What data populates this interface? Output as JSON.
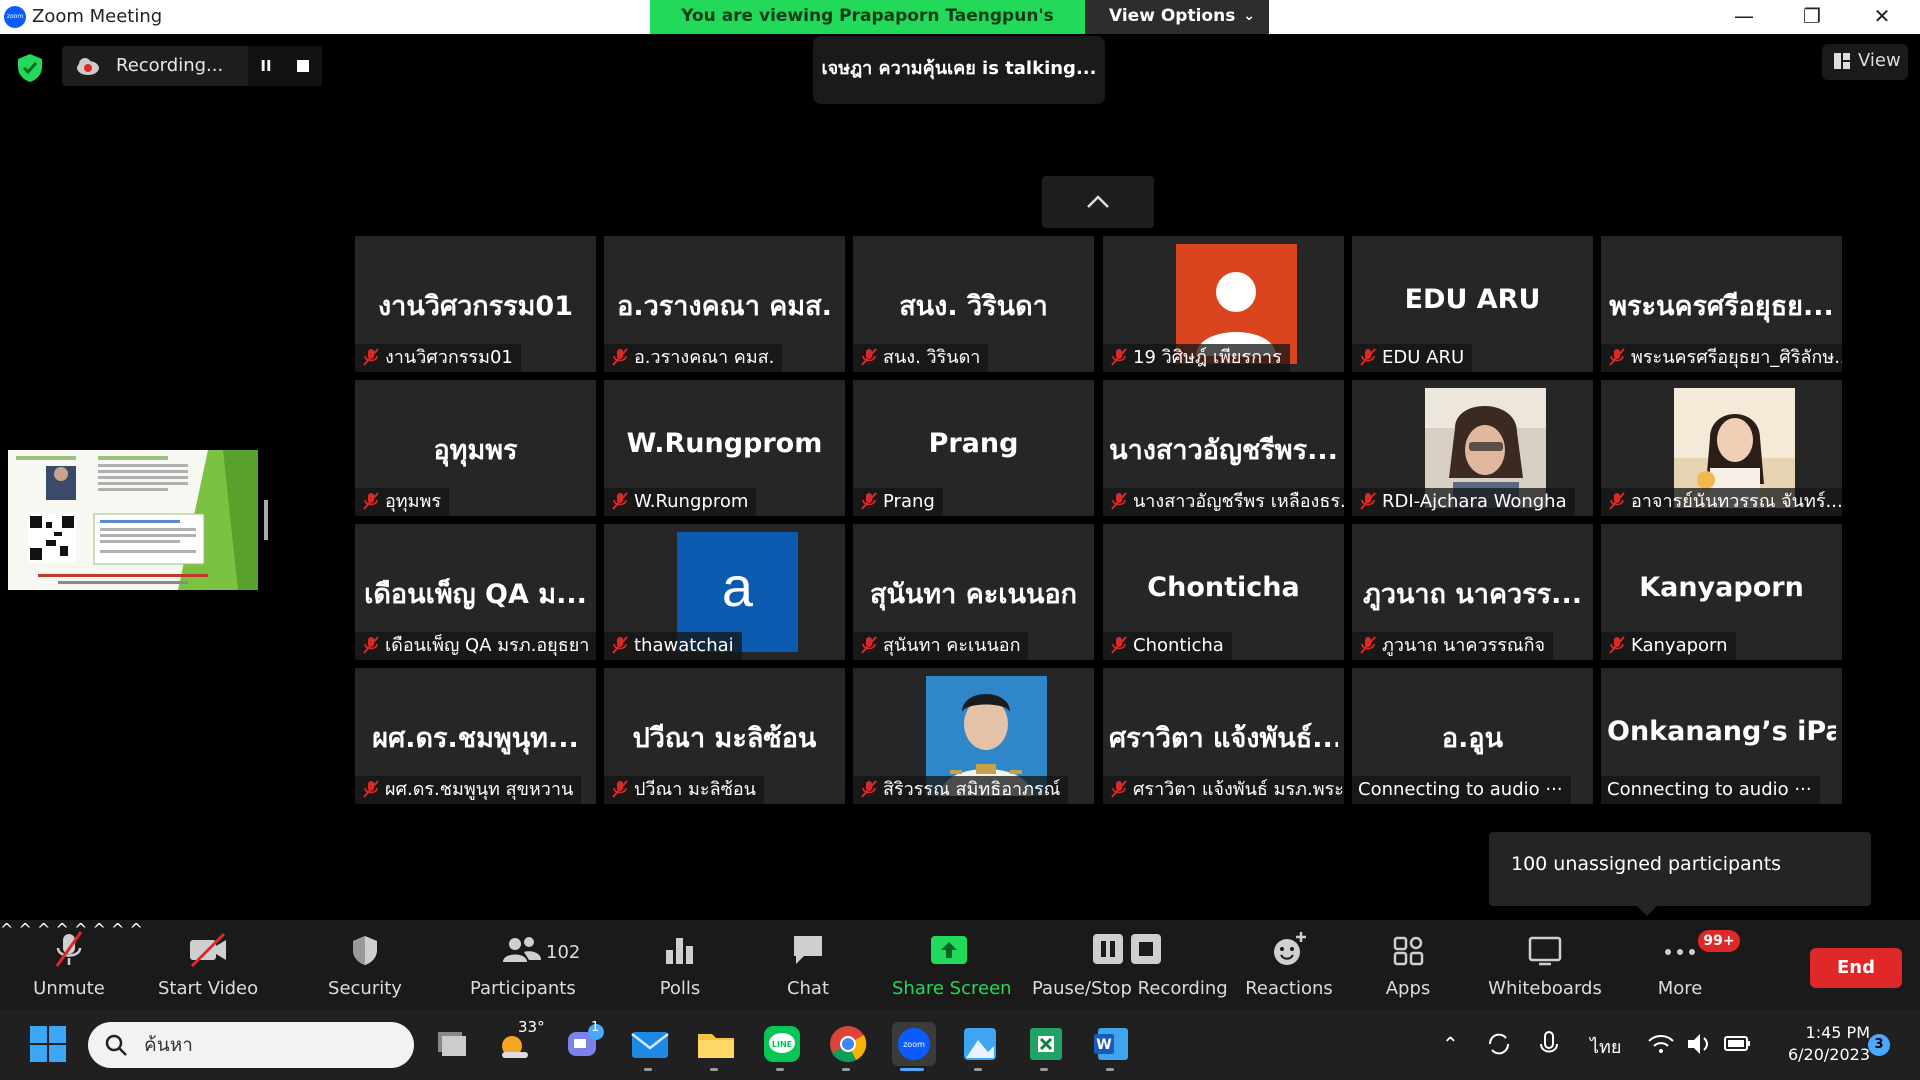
{
  "window": {
    "title": "Zoom Meeting",
    "share_banner": "You are viewing Prapaporn Taengpun's screen",
    "view_options": "View Options",
    "minimize": "—",
    "maximize": "❐",
    "close": "✕"
  },
  "recording": {
    "label": "Recording...",
    "pause": "II"
  },
  "talking": "เจษฎา ความคุ้นเคย is  talking...",
  "view_button": "View",
  "colors": {
    "share_green": "#23d959",
    "muted_red": "#e02828",
    "tile_bg": "#262626",
    "accent_green": "#23d959"
  },
  "participants": [
    {
      "display": "งานวิศวกรรม01",
      "label": "งานวิศวกรรม01",
      "muted": true
    },
    {
      "display": "อ.วรางคณา คมส.",
      "label": "อ.วรางคณา คมส.",
      "muted": true
    },
    {
      "display": "สนง. วิรินดา",
      "label": "สนง. วิรินดา",
      "muted": true
    },
    {
      "display": "",
      "label": "19 วิศิษฎ์ เพียรการ",
      "muted": true,
      "photo": "default-avatar"
    },
    {
      "display": "EDU ARU",
      "label": "EDU ARU",
      "muted": true
    },
    {
      "display": "พระนครศรีอยุธย...",
      "label": "พระนครศรีอยุธยา_ศิริลักษ...",
      "muted": true
    },
    {
      "display": "อุทุมพร",
      "label": "อุทุมพร",
      "muted": true
    },
    {
      "display": "W.Rungprom",
      "label": "W.Rungprom",
      "muted": true
    },
    {
      "display": "Prang",
      "label": "Prang",
      "muted": true
    },
    {
      "display": "นางสาวอัญชรีพร...",
      "label": "นางสาวอัญชรีพร เหลืองธร...",
      "muted": true
    },
    {
      "display": "",
      "label": "RDI-Ajchara Wongha",
      "muted": true,
      "photo": "woman-selfie"
    },
    {
      "display": "",
      "label": "อาจารย์นันทวรรณ จันทร์...",
      "muted": true,
      "photo": "woman-smiling"
    },
    {
      "display": "เดือนเพ็ญ  QA ม...",
      "label": "เดือนเพ็ญ  QA มรภ.อยุธยา",
      "muted": true
    },
    {
      "display": "",
      "label": "thawatchai",
      "muted": true,
      "photo": "letter-avatar",
      "avatar_letter": "a"
    },
    {
      "display": "สุนันทา คะเนนอก",
      "label": "สุนันทา คะเนนอก",
      "muted": true
    },
    {
      "display": "Chonticha",
      "label": "Chonticha",
      "muted": true
    },
    {
      "display": "ภูวนาถ  นาควรร...",
      "label": "ภูวนาถ  นาควรรณกิจ",
      "muted": true
    },
    {
      "display": "Kanyaporn",
      "label": "Kanyaporn",
      "muted": true
    },
    {
      "display": "ผศ.ดร.ชมพูนุท...",
      "label": "ผศ.ดร.ชมพูนุท  สุขหวาน",
      "muted": true
    },
    {
      "display": "ปวีณา มะลิซ้อน",
      "label": "ปวีณา มะลิซ้อน",
      "muted": true
    },
    {
      "display": "",
      "label": "สิริวรรณ สมิทธิอาภรณ์",
      "muted": true,
      "photo": "uniform-portrait"
    },
    {
      "display": "ศราวิตา แจ้งพันธ์...",
      "label": "ศราวิตา แจ้งพันธ์ มรภ.พระ...",
      "muted": true
    },
    {
      "display": "อ.อูน",
      "label": "Connecting to audio ···",
      "muted": false
    },
    {
      "display": "Onkanang’s iPad",
      "label": "Connecting to audio ···",
      "muted": false
    }
  ],
  "tooltip": "100 unassigned participants",
  "toolbar": {
    "unmute": "Unmute",
    "start_video": "Start Video",
    "security": "Security",
    "participants": "Participants",
    "participants_count": "102",
    "polls": "Polls",
    "chat": "Chat",
    "share_screen": "Share Screen",
    "pause_stop": "Pause/Stop Recording",
    "reactions": "Reactions",
    "apps": "Apps",
    "whiteboards": "Whiteboards",
    "more": "More",
    "more_badge": "99+",
    "end": "End",
    "caret": "^"
  },
  "taskbar": {
    "search_placeholder": "ค้นหา",
    "weather_temp": "33°",
    "teams_badge": "1",
    "zoom_label": "zoom",
    "line_label": "LINE",
    "language": "ไทย",
    "time": "1:45 PM",
    "date": "6/20/2023",
    "notifications": "3"
  }
}
